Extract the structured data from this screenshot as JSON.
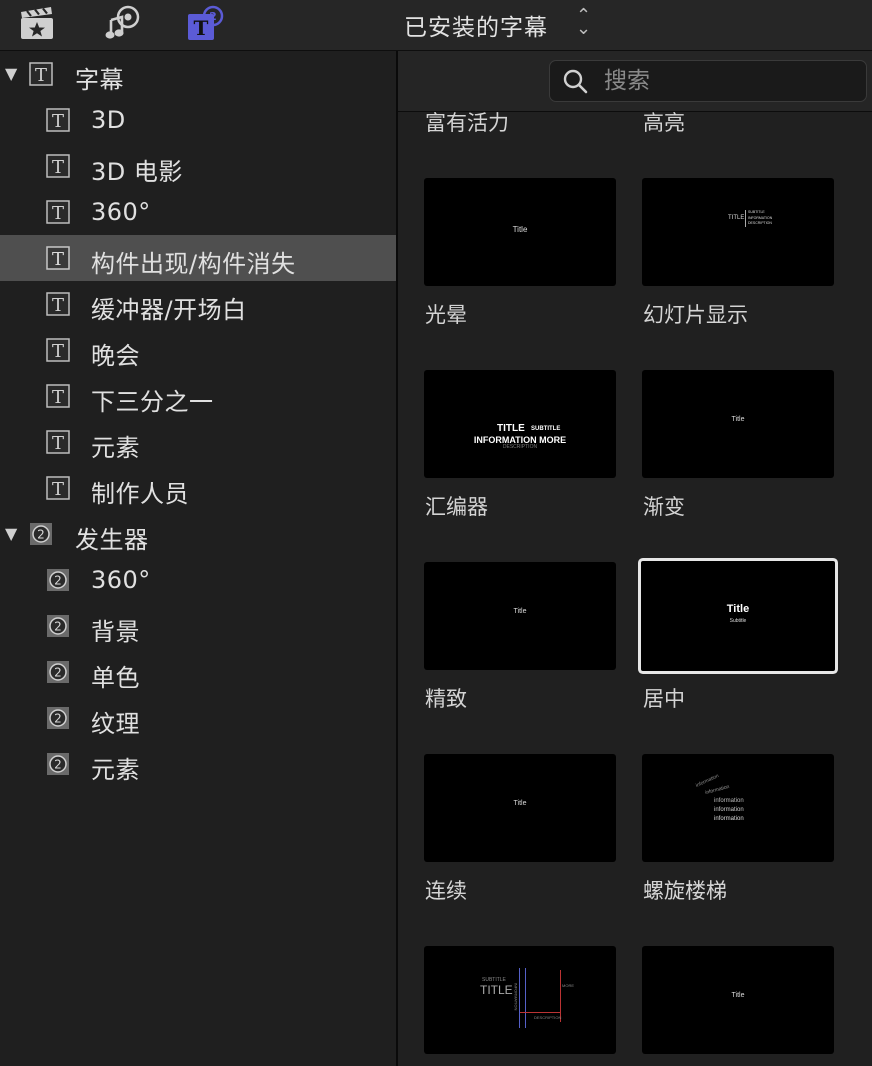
{
  "toolbar": {
    "library_title": "已安装的字幕",
    "icons": [
      "clapperboard-star-icon",
      "photos-music-icon",
      "titles-generators-icon"
    ]
  },
  "colors": {
    "accent": "#5b5bd6",
    "selection": "#4f4f4f",
    "background": "#1e1e1e"
  },
  "sidebar": {
    "titles_group": {
      "label": "字幕",
      "items": [
        {
          "label": "3D"
        },
        {
          "label": "3D 电影"
        },
        {
          "label": "360°"
        },
        {
          "label": "构件出现/构件消失",
          "selected": true
        },
        {
          "label": "缓冲器/开场白"
        },
        {
          "label": "晚会"
        },
        {
          "label": "下三分之一"
        },
        {
          "label": "元素"
        },
        {
          "label": "制作人员"
        }
      ]
    },
    "generators_group": {
      "label": "发生器",
      "items": [
        {
          "label": "360°"
        },
        {
          "label": "背景"
        },
        {
          "label": "单色"
        },
        {
          "label": "纹理"
        },
        {
          "label": "元素"
        }
      ]
    }
  },
  "search": {
    "placeholder": "搜索"
  },
  "browser": {
    "top_labels": [
      "富有活力",
      "高亮"
    ],
    "tiles": [
      {
        "name": "光晕",
        "thumb_text": "Title"
      },
      {
        "name": "幻灯片显示",
        "thumb_title": "TITLE",
        "thumb_lines": [
          "SUBTITLE",
          "INFORMATION",
          "DESCRIPTION"
        ]
      },
      {
        "name": "汇编器",
        "thumb_line1": "TITLE",
        "thumb_line1b": "SUBTITLE",
        "thumb_line2": "INFORMATION MORE",
        "thumb_line3": "DESCRIPTION"
      },
      {
        "name": "渐变",
        "thumb_text": "Title"
      },
      {
        "name": "精致",
        "thumb_text": "Title"
      },
      {
        "name": "居中",
        "thumb_title": "Title",
        "thumb_subtitle": "Subtitle",
        "selected": true
      },
      {
        "name": "连续",
        "thumb_text": "Title"
      },
      {
        "name": "螺旋楼梯",
        "thumb_lines": [
          "information",
          "information",
          "information",
          "information",
          "information"
        ]
      },
      {
        "name": "",
        "thumb_title": "TITLE",
        "thumb_subtitle": "SUBTITLE",
        "thumb_side": "MORE",
        "thumb_desc": "DESCRIPTION",
        "thumb_vertical": "INFORMATION"
      },
      {
        "name": "",
        "thumb_text": "Title"
      }
    ]
  }
}
